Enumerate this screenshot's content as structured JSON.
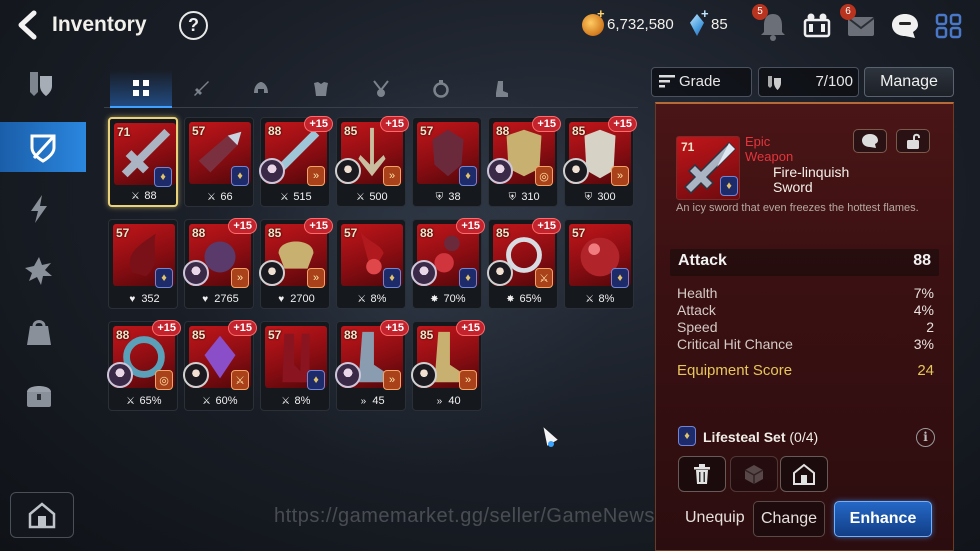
{
  "header": {
    "title": "Inventory",
    "help": "?",
    "gold": "6,732,580",
    "crystals": "85",
    "resource_plus": "+",
    "notification_badges": [
      "5",
      "6"
    ]
  },
  "tabs": [
    "All",
    "Weapon",
    "Helmet",
    "Armor",
    "Necklace",
    "Ring",
    "Boots"
  ],
  "filters": {
    "grade_label": "Grade",
    "capacity": "7/100",
    "manage_label": "Manage"
  },
  "items": [
    {
      "level": "71",
      "plus": "",
      "stat_icon": "attack",
      "stat": "88",
      "set": "lifesteal",
      "hero": ""
    },
    {
      "level": "57",
      "plus": "",
      "stat_icon": "attack",
      "stat": "66",
      "set": "lifesteal",
      "hero": ""
    },
    {
      "level": "88",
      "plus": "+15",
      "stat_icon": "attack",
      "stat": "515",
      "set": "speed",
      "hero": "light"
    },
    {
      "level": "85",
      "plus": "+15",
      "stat_icon": "attack",
      "stat": "500",
      "set": "speed",
      "hero": "dark"
    },
    {
      "level": "57",
      "plus": "",
      "stat_icon": "defense",
      "stat": "38",
      "set": "lifesteal",
      "hero": ""
    },
    {
      "level": "88",
      "plus": "+15",
      "stat_icon": "defense",
      "stat": "310",
      "set": "counter",
      "hero": "light"
    },
    {
      "level": "85",
      "plus": "+15",
      "stat_icon": "defense",
      "stat": "300",
      "set": "speed",
      "hero": "dark"
    },
    {
      "level": "57",
      "plus": "",
      "stat_icon": "health",
      "stat": "352",
      "set": "lifesteal",
      "hero": ""
    },
    {
      "level": "88",
      "plus": "+15",
      "stat_icon": "health",
      "stat": "2765",
      "set": "speed",
      "hero": "light"
    },
    {
      "level": "85",
      "plus": "+15",
      "stat_icon": "health",
      "stat": "2700",
      "set": "speed",
      "hero": "dark"
    },
    {
      "level": "57",
      "plus": "",
      "stat_icon": "attack",
      "stat": "8%",
      "set": "lifesteal",
      "hero": ""
    },
    {
      "level": "88",
      "plus": "+15",
      "stat_icon": "crit",
      "stat": "70%",
      "set": "lifesteal",
      "hero": "light"
    },
    {
      "level": "85",
      "plus": "+15",
      "stat_icon": "crit",
      "stat": "65%",
      "set": "attack",
      "hero": "dark"
    },
    {
      "level": "57",
      "plus": "",
      "stat_icon": "attack",
      "stat": "8%",
      "set": "lifesteal",
      "hero": ""
    },
    {
      "level": "88",
      "plus": "+15",
      "stat_icon": "attack",
      "stat": "65%",
      "set": "counter",
      "hero": "light"
    },
    {
      "level": "85",
      "plus": "+15",
      "stat_icon": "attack",
      "stat": "60%",
      "set": "attack",
      "hero": "dark"
    },
    {
      "level": "57",
      "plus": "",
      "stat_icon": "attack",
      "stat": "8%",
      "set": "lifesteal",
      "hero": ""
    },
    {
      "level": "88",
      "plus": "+15",
      "stat_icon": "speed",
      "stat": "45",
      "set": "speed",
      "hero": "light"
    },
    {
      "level": "85",
      "plus": "+15",
      "stat_icon": "speed",
      "stat": "40",
      "set": "speed",
      "hero": "dark"
    }
  ],
  "detail": {
    "level": "71",
    "rarity_line1": "Epic",
    "rarity_line2": "Weapon",
    "name_line1": "Fire-linquish",
    "name_line2": "Sword",
    "description": "An icy sword that even freezes the hottest flames.",
    "main_stat": {
      "label": "Attack",
      "value": "88"
    },
    "substats": [
      {
        "label": "Health",
        "value": "7%"
      },
      {
        "label": "Attack",
        "value": "4%"
      },
      {
        "label": "Speed",
        "value": "2"
      },
      {
        "label": "Critical Hit Chance",
        "value": "3%"
      }
    ],
    "score": {
      "label": "Equipment Score",
      "value": "24"
    },
    "set_name": "Lifesteal Set",
    "set_count": "(0/4)",
    "info": "i",
    "buttons": {
      "unequip": "Unequip",
      "change": "Change",
      "enhance": "Enhance"
    }
  },
  "watermark": "https://gamemarket.gg/seller/GameNews",
  "colors": {
    "accent_blue": "#2b87df",
    "rarity_epic": "#e5343c",
    "score_gold": "#e8c65a",
    "plus_badge": "#c2232c"
  }
}
